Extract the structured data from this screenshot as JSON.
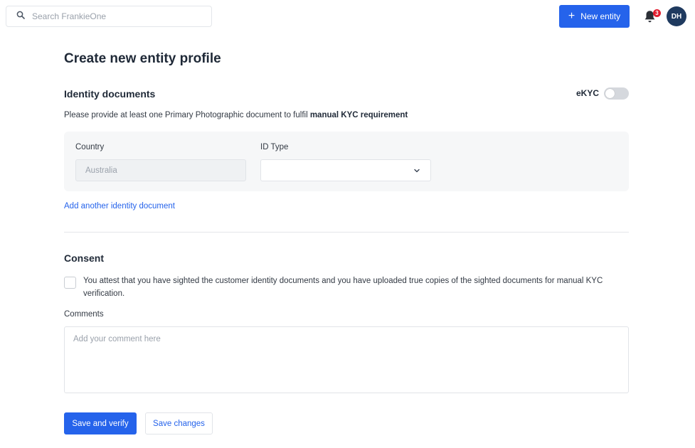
{
  "search": {
    "placeholder": "Search FrankieOne",
    "icon": "search-icon"
  },
  "header": {
    "new_entity_label": "New entity",
    "notification_count": "3",
    "avatar_initials": "DH",
    "accent_color": "#2563eb",
    "badge_color": "#e11d2e"
  },
  "page": {
    "title": "Create new entity profile"
  },
  "identity": {
    "section_title": "Identity documents",
    "ekyc_label": "eKYC",
    "ekyc_enabled": false,
    "instructions_prefix": "Please provide at least one Primary Photographic document to fulfil ",
    "instructions_bold": "manual KYC requirement",
    "country_label": "Country",
    "country_value": "Australia",
    "id_type_label": "ID Type",
    "id_type_value": "",
    "add_link": "Add another identity document"
  },
  "consent": {
    "section_title": "Consent",
    "checked": false,
    "text": "You attest that you have sighted the customer identity documents and you have uploaded true copies of the sighted documents for manual KYC verification.",
    "comments_label": "Comments",
    "comments_placeholder": "Add your comment here"
  },
  "actions": {
    "save_verify_label": "Save and verify",
    "save_changes_label": "Save changes"
  }
}
